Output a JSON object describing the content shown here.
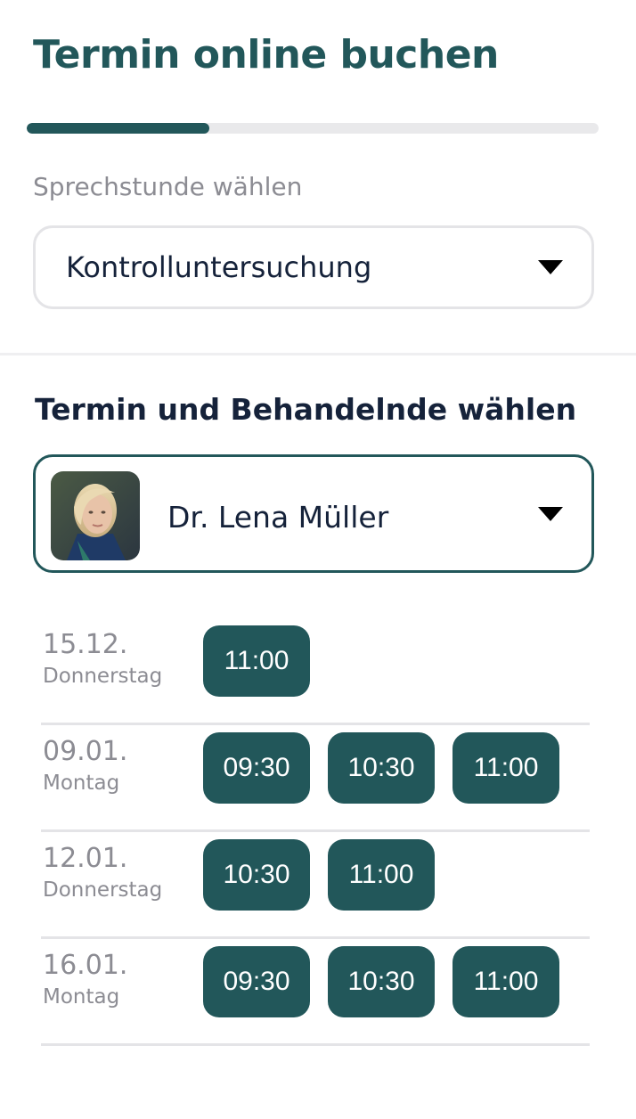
{
  "page": {
    "title": "Termin online buchen",
    "progress_fraction": 0.32
  },
  "appointment_type": {
    "label": "Sprechstunde wählen",
    "selected": "Kontrolluntersuchung"
  },
  "practitioner": {
    "heading": "Termin und Behandelnde wählen",
    "selected_name": "Dr. Lena Müller"
  },
  "days": [
    {
      "date": "15.12.",
      "weekday": "Donnerstag",
      "slots": [
        "11:00"
      ]
    },
    {
      "date": "09.01.",
      "weekday": "Montag",
      "slots": [
        "09:30",
        "10:30",
        "11:00"
      ]
    },
    {
      "date": "12.01.",
      "weekday": "Donnerstag",
      "slots": [
        "10:30",
        "11:00"
      ]
    },
    {
      "date": "16.01.",
      "weekday": "Montag",
      "slots": [
        "09:30",
        "10:30",
        "11:00"
      ]
    }
  ],
  "colors": {
    "accent": "#22575a",
    "text": "#15223a",
    "muted": "#8c8c93",
    "border": "#e4e4e7"
  },
  "icons": {
    "dropdown": "caret-down-icon"
  }
}
